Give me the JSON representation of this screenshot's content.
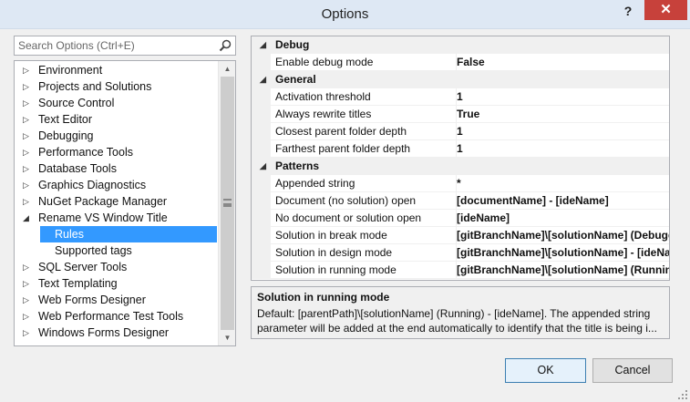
{
  "window": {
    "title": "Options",
    "help_label": "?",
    "close_label": "✕"
  },
  "search": {
    "placeholder": "Search Options (Ctrl+E)",
    "value": ""
  },
  "tree": {
    "items": [
      {
        "label": "Environment",
        "expanded": false
      },
      {
        "label": "Projects and Solutions",
        "expanded": false
      },
      {
        "label": "Source Control",
        "expanded": false
      },
      {
        "label": "Text Editor",
        "expanded": false
      },
      {
        "label": "Debugging",
        "expanded": false
      },
      {
        "label": "Performance Tools",
        "expanded": false
      },
      {
        "label": "Database Tools",
        "expanded": false
      },
      {
        "label": "Graphics Diagnostics",
        "expanded": false
      },
      {
        "label": "NuGet Package Manager",
        "expanded": false
      },
      {
        "label": "Rename VS Window Title",
        "expanded": true
      },
      {
        "label": "Rules",
        "child": true,
        "selected": true
      },
      {
        "label": "Supported tags",
        "child": true
      },
      {
        "label": "SQL Server Tools",
        "expanded": false
      },
      {
        "label": "Text Templating",
        "expanded": false
      },
      {
        "label": "Web Forms Designer",
        "expanded": false
      },
      {
        "label": "Web Performance Test Tools",
        "expanded": false
      },
      {
        "label": "Windows Forms Designer",
        "expanded": false
      }
    ]
  },
  "grid": {
    "categories": [
      {
        "name": "Debug",
        "properties": [
          {
            "name": "Enable debug mode",
            "value": "False"
          }
        ]
      },
      {
        "name": "General",
        "properties": [
          {
            "name": "Activation threshold",
            "value": "1"
          },
          {
            "name": "Always rewrite titles",
            "value": "True"
          },
          {
            "name": "Closest parent folder depth",
            "value": "1"
          },
          {
            "name": "Farthest parent folder depth",
            "value": "1"
          }
        ]
      },
      {
        "name": "Patterns",
        "properties": [
          {
            "name": "Appended string",
            "value": "*"
          },
          {
            "name": "Document (no solution) open",
            "value": "[documentName] - [ideName]"
          },
          {
            "name": "No document or solution open",
            "value": "[ideName]"
          },
          {
            "name": "Solution in break mode",
            "value": "[gitBranchName]\\[solutionName] (Debugg"
          },
          {
            "name": "Solution in design mode",
            "value": "[gitBranchName]\\[solutionName] - [ideNa"
          },
          {
            "name": "Solution in running mode",
            "value": "[gitBranchName]\\[solutionName] (Running"
          }
        ]
      }
    ]
  },
  "description": {
    "title": "Solution in running mode",
    "text": "Default: [parentPath]\\[solutionName] (Running) - [ideName]. The appended string parameter will be added at the end automatically to identify that the title is being i..."
  },
  "buttons": {
    "ok": "OK",
    "cancel": "Cancel"
  },
  "colors": {
    "selection": "#3399ff",
    "close": "#c7413b",
    "titlebar": "#dee8f4"
  }
}
